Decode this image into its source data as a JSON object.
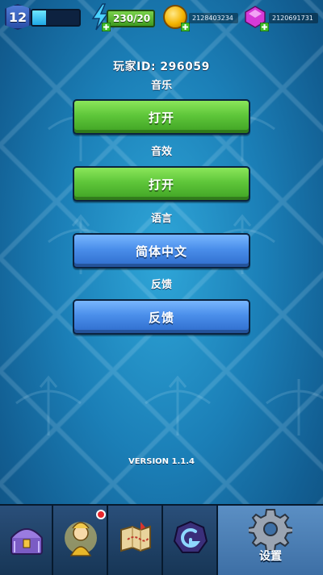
{
  "topbar": {
    "level": "12",
    "xp_progress": 0.3,
    "energy": "230/20",
    "coins": "2128403234",
    "gems": "2120691731"
  },
  "settings": {
    "player_id": "玩家ID: 296059",
    "music_label": "音乐",
    "music_button": "打开",
    "sfx_label": "音效",
    "sfx_button": "打开",
    "language_label": "语言",
    "language_button": "简体中文",
    "feedback_label": "反馈",
    "feedback_button": "反馈"
  },
  "version": "VERSION 1.1.4",
  "bottom_nav": {
    "items": [
      {
        "icon": "chest-icon"
      },
      {
        "icon": "hero-icon",
        "notification": true
      },
      {
        "icon": "map-icon"
      },
      {
        "icon": "rune-icon"
      },
      {
        "icon": "gear-icon",
        "label": "设置",
        "active": true
      }
    ]
  },
  "colors": {
    "button_green": "#5ec63a",
    "button_blue": "#4a8eea",
    "background": "#1b7fb7"
  }
}
